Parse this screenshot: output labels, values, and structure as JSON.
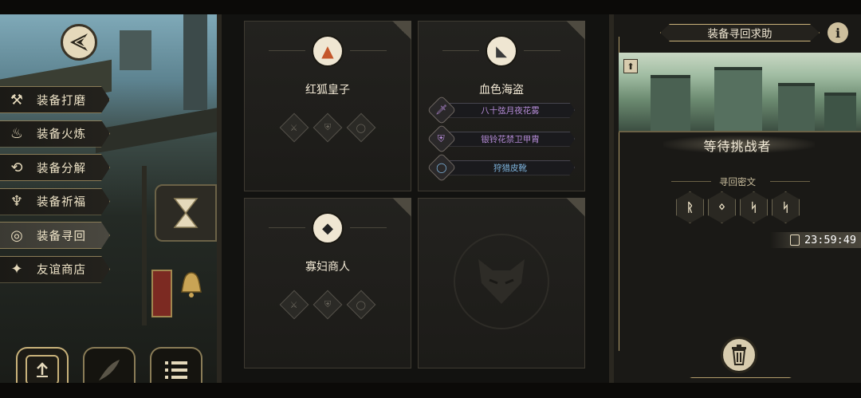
{
  "sidebar": {
    "items": [
      {
        "label": "装备打磨",
        "icon": "hammer-icon",
        "glyph": "⚒",
        "active": false
      },
      {
        "label": "装备火炼",
        "icon": "flame-icon",
        "glyph": "🔥",
        "active": false
      },
      {
        "label": "装备分解",
        "icon": "disassemble-icon",
        "glyph": "⟲",
        "active": false
      },
      {
        "label": "装备祈福",
        "icon": "pray-icon",
        "glyph": "♆",
        "active": false
      },
      {
        "label": "装备寻回",
        "icon": "retrieve-icon",
        "glyph": "◎",
        "active": true
      },
      {
        "label": "友谊商店",
        "icon": "fox-shop-icon",
        "glyph": "✦",
        "active": false
      }
    ]
  },
  "bottom_nav": [
    {
      "icon": "upload-icon",
      "glyph": "⬆"
    },
    {
      "icon": "feather-icon",
      "glyph": "✒"
    },
    {
      "icon": "list-icon",
      "glyph": "☰"
    }
  ],
  "cards": [
    {
      "name": "红狐皇子",
      "portrait": "red-fox-prince-portrait",
      "glyph": "🦊",
      "slots": [
        "weapon",
        "armor",
        "ring"
      ]
    },
    {
      "name": "血色海盗",
      "portrait": "blood-pirate-portrait",
      "glyph": "🦈",
      "equipment": [
        {
          "label": "八十弦月夜花雾",
          "icon": "sword-icon",
          "glyph": "🗡",
          "color": "#b68cd8"
        },
        {
          "label": "银铃花禁卫甲胄",
          "icon": "armor-icon",
          "glyph": "⛨",
          "color": "#b68cd8"
        },
        {
          "label": "狩猎皮靴",
          "icon": "boots-icon",
          "glyph": "◯",
          "color": "#7fb6e0"
        }
      ]
    },
    {
      "name": "寡妇商人",
      "portrait": "widow-merchant-portrait",
      "glyph": "🐦",
      "slots": [
        "weapon",
        "armor",
        "ring"
      ]
    },
    {
      "name": "",
      "portrait": "empty-fox-emblem",
      "glyph": ""
    }
  ],
  "help_panel": {
    "title": "装备寻回求助",
    "info": "i",
    "status": "等待挑战者",
    "cipher_title": "寻回密文",
    "ciphers": [
      "ᚱ",
      "ᛜ",
      "ᛋ",
      "ᛋ"
    ],
    "timer": "23:59:49"
  },
  "colors": {
    "accent": "#c9b27a",
    "purple_item": "#b68cd8",
    "blue_item": "#7fb6e0"
  }
}
